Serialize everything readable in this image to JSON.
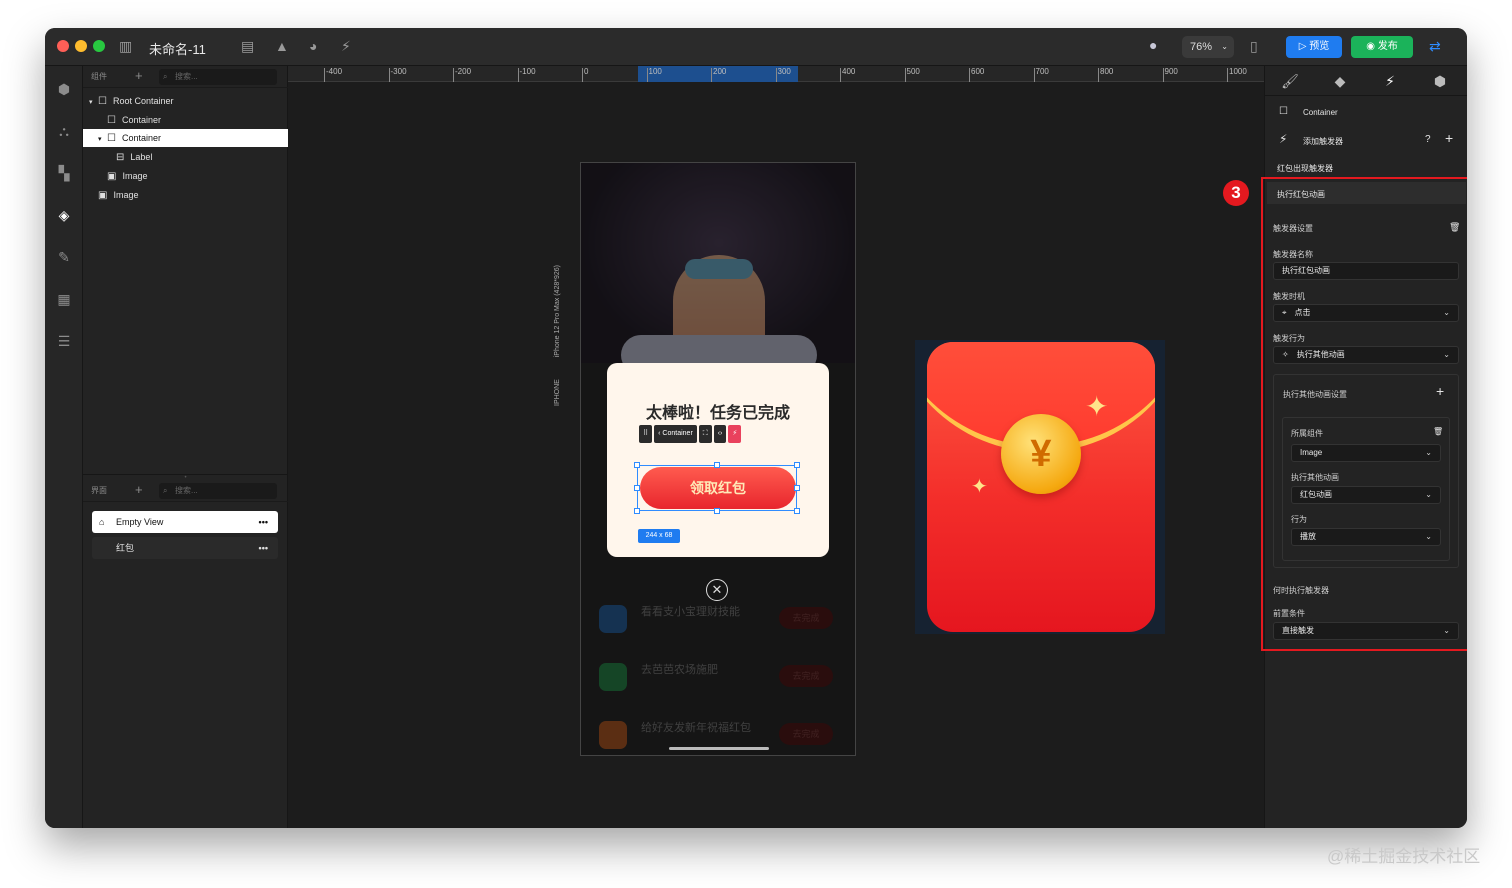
{
  "window": {
    "doc_title": "未命名-11",
    "zoom": "76%",
    "preview_label": "预览",
    "publish_label": "发布"
  },
  "layers_panel": {
    "components_label": "组件",
    "search_placeholder": "搜索...",
    "tree": [
      {
        "label": "Root Container",
        "indent": 0,
        "toggle": "▾",
        "icon": "box"
      },
      {
        "label": "Container",
        "indent": 1,
        "toggle": "",
        "icon": "box"
      },
      {
        "label": "Container",
        "indent": 1,
        "toggle": "▾",
        "icon": "box",
        "selected": true
      },
      {
        "label": "Label",
        "indent": 2,
        "toggle": "",
        "icon": "text"
      },
      {
        "label": "Image",
        "indent": 1,
        "toggle": "",
        "icon": "image"
      },
      {
        "label": "Image",
        "indent": 0,
        "toggle": "",
        "icon": "image"
      }
    ],
    "pages_label": "界面",
    "pages_search_placeholder": "搜索...",
    "pages": [
      {
        "label": "Empty View",
        "active": true
      },
      {
        "label": "红包",
        "active": false
      }
    ]
  },
  "ruler": {
    "ticks": [
      "-400",
      "-300",
      "-200",
      "-100",
      "0",
      "100",
      "200",
      "300",
      "400",
      "500",
      "600",
      "700",
      "800",
      "900",
      "1000"
    ]
  },
  "device_label": "iPhone 12 Pro Max (428*926)",
  "device_type": "IPHONE",
  "phone": {
    "dialog_title": "太棒啦！任务已完成",
    "claim_button": "领取红包",
    "toolbar_container": "Container",
    "size_badge": "244 x 68",
    "tasks": [
      {
        "title": "看看支小宝理财技能",
        "action": "去完成"
      },
      {
        "title": "去芭芭农场施肥",
        "action": "去完成"
      },
      {
        "title": "给好友发新年祝福红包",
        "action": "去完成"
      }
    ]
  },
  "envelope": {
    "coin_symbol": "¥"
  },
  "inspector": {
    "selected_component": "Container",
    "add_trigger": "添加触发器",
    "trigger_list_item_1": "红包出现触发器",
    "trigger_list_item_2": "执行红包动画",
    "settings_title": "触发器设置",
    "name_label": "触发器名称",
    "name_value": "执行红包动画",
    "timing_label": "触发时机",
    "timing_value": "点击",
    "action_label": "触发行为",
    "action_value": "执行其他动画",
    "other_anim_title": "执行其他动画设置",
    "owner_label": "所属组件",
    "owner_value": "Image",
    "exec_anim_label": "执行其他动画",
    "exec_anim_value": "红包动画",
    "behavior_label": "行为",
    "behavior_value": "播放",
    "when_label": "何时执行触发器",
    "precondition_label": "前置条件",
    "precondition_value": "直接触发"
  },
  "annotation": {
    "marker": "3"
  },
  "watermark": "@稀土掘金技术社区",
  "colors": {
    "accent_blue": "#1f7cf0",
    "publish_green": "#1bb35a",
    "highlight_red": "#e4191f",
    "envelope_red": "#f32d2a",
    "coin_gold": "#f5a80f"
  }
}
